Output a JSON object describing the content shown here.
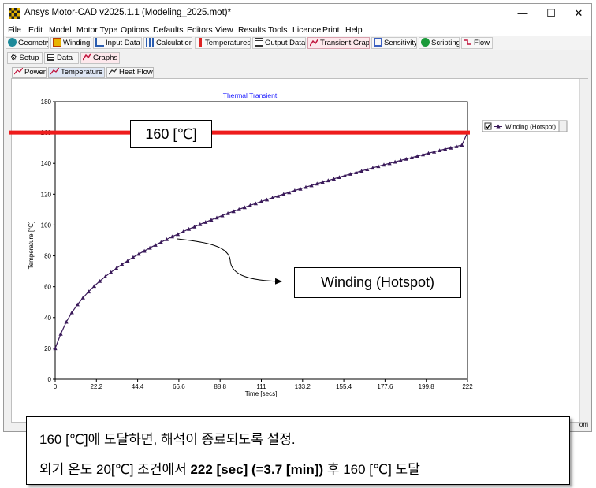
{
  "window": {
    "title": "Ansys Motor-CAD v2025.1.1 (Modeling_2025.mot)*",
    "controls": {
      "minimize": "—",
      "maximize": "☐",
      "close": "✕"
    }
  },
  "menu": [
    "File",
    "Edit",
    "Model",
    "Motor Type",
    "Options",
    "Defaults",
    "Editors",
    "View",
    "Results",
    "Tools",
    "Licence",
    "Print",
    "Help"
  ],
  "toolbar": [
    {
      "label": "Geometry",
      "icon": "geometry-icon"
    },
    {
      "label": "Winding",
      "icon": "winding-icon"
    },
    {
      "label": "Input Data",
      "icon": "input-data-icon"
    },
    {
      "label": "Calculation",
      "icon": "calculation-icon"
    },
    {
      "label": "Temperatures",
      "icon": "thermometer-icon"
    },
    {
      "label": "Output Data",
      "icon": "output-data-icon"
    },
    {
      "label": "Transient Graph",
      "icon": "transient-graph-icon",
      "active": true
    },
    {
      "label": "Sensitivity",
      "icon": "sensitivity-icon"
    },
    {
      "label": "Scripting",
      "icon": "scripting-icon"
    },
    {
      "label": "Flow",
      "icon": "flow-icon"
    }
  ],
  "subtabs": [
    {
      "label": "Setup",
      "icon": "gear-icon"
    },
    {
      "label": "Data",
      "icon": "table-icon"
    },
    {
      "label": "Graphs",
      "icon": "graph-icon",
      "active": true
    }
  ],
  "graphtabs": [
    {
      "label": "Power",
      "icon": "graph-icon"
    },
    {
      "label": "Temperature",
      "icon": "graph-icon",
      "active": true
    },
    {
      "label": "Heat Flow",
      "icon": "graph-icon"
    }
  ],
  "status_tail": "om",
  "chart_data": {
    "type": "line",
    "title": "Thermal Transient",
    "xlabel": "Time [secs]",
    "ylabel": "Temperature [°C]",
    "xlim": [
      0,
      222
    ],
    "ylim": [
      0,
      180
    ],
    "xticks": [
      "0",
      "22.2",
      "44.4",
      "66.6",
      "88.8",
      "111",
      "133.2",
      "155.4",
      "177.6",
      "199.8",
      "222"
    ],
    "yticks": [
      "0",
      "20",
      "40",
      "60",
      "80",
      "100",
      "120",
      "140",
      "160",
      "180"
    ],
    "series": [
      {
        "name": "Winding (Hotspot)",
        "color": "#3a1a5a",
        "marker": "triangle",
        "x": [
          0,
          3,
          6,
          9,
          12,
          15,
          18,
          21,
          24,
          27,
          30,
          33,
          36,
          39,
          42,
          45,
          48,
          51,
          54,
          57,
          60,
          63,
          66,
          69,
          72,
          75,
          78,
          81,
          84,
          87,
          90,
          93,
          96,
          99,
          102,
          105,
          108,
          111,
          114,
          117,
          120,
          123,
          126,
          129,
          132,
          135,
          138,
          141,
          144,
          147,
          150,
          153,
          156,
          159,
          162,
          165,
          168,
          171,
          174,
          177,
          180,
          183,
          186,
          189,
          192,
          195,
          198,
          201,
          204,
          207,
          210,
          213,
          216,
          219,
          222
        ],
        "y": [
          20,
          29.4,
          37.2,
          43.3,
          48.5,
          52.9,
          56.8,
          60.4,
          63.6,
          66.6,
          69.4,
          72,
          74.5,
          76.8,
          79.1,
          81.2,
          83.2,
          85.2,
          87.1,
          88.9,
          90.7,
          92.5,
          94.1,
          95.8,
          97.4,
          98.9,
          100.5,
          101.9,
          103.4,
          104.8,
          106.2,
          107.6,
          108.9,
          110.2,
          111.5,
          112.8,
          114,
          115.3,
          116.5,
          117.7,
          118.9,
          120.1,
          121.2,
          122.4,
          123.5,
          124.6,
          125.7,
          126.8,
          127.9,
          128.9,
          130,
          131,
          132.1,
          133.1,
          134.1,
          135.1,
          136.1,
          137.1,
          138.1,
          139.1,
          140,
          141,
          141.9,
          142.9,
          143.8,
          144.7,
          145.7,
          146.6,
          147.5,
          148.4,
          149.3,
          150.1,
          151,
          151.9,
          160
        ]
      }
    ],
    "threshold": {
      "value": 160,
      "color": "#ee1c1c"
    },
    "legend": {
      "position": "right",
      "checked": true
    }
  },
  "annotations": {
    "threshold_label": "160 [℃]",
    "series_label": "Winding (Hotspot)"
  },
  "note": {
    "line1": "160 [℃]에 도달하면, 해석이 종료되도록 설정.",
    "line2_pre": "외기 온도 20[℃] 조건에서 ",
    "line2_bold": "222 [sec] (=3.7 [min])",
    "line2_post": " 후 160 [℃] 도달"
  }
}
